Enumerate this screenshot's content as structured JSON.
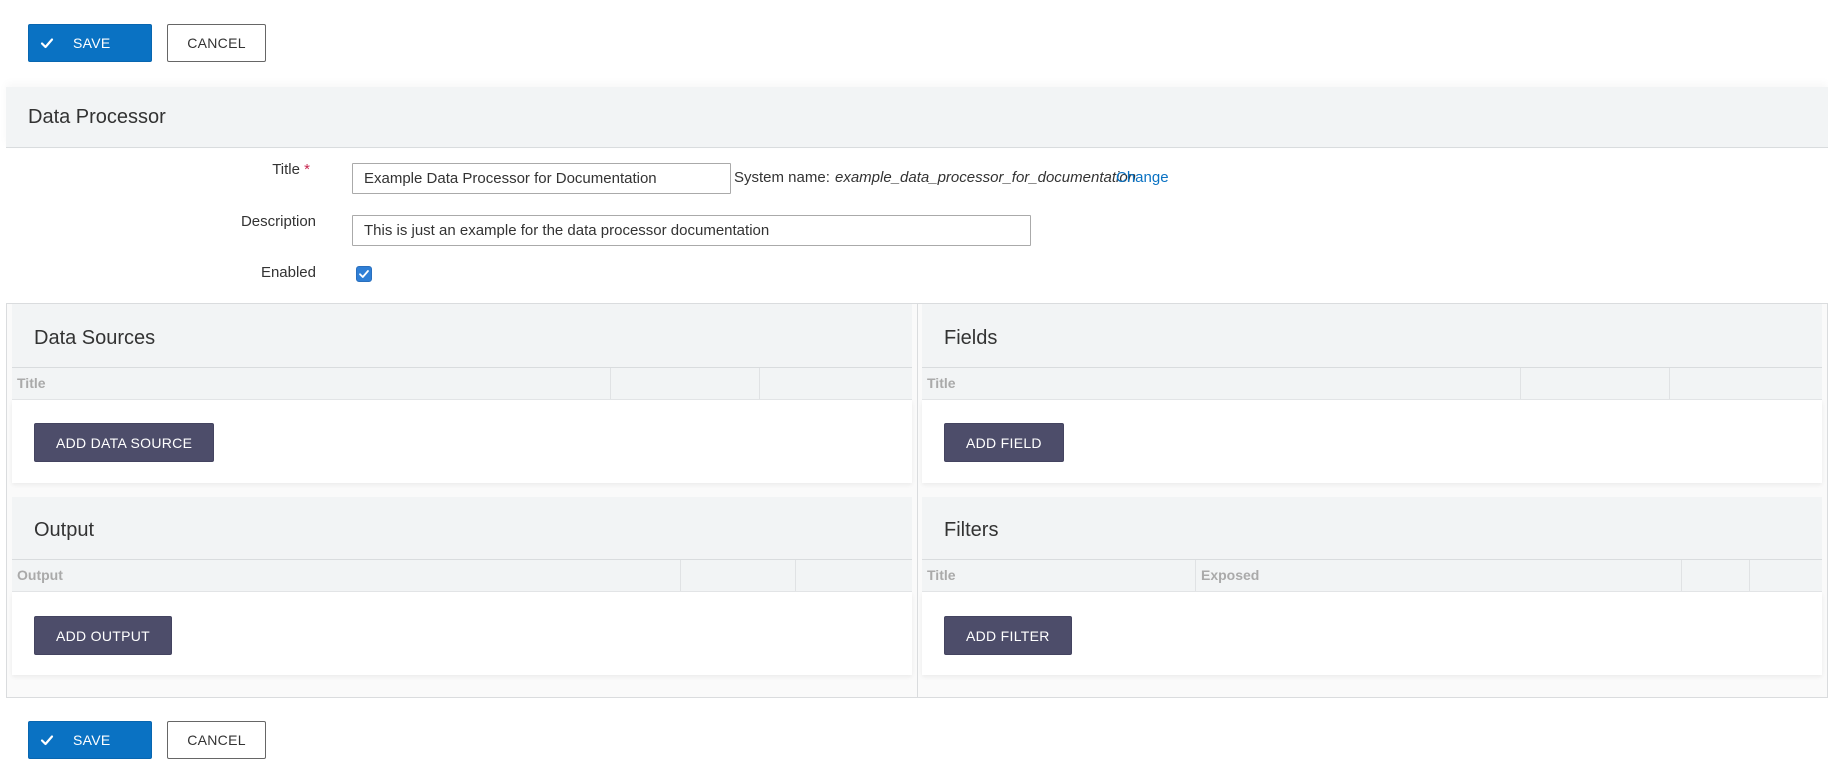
{
  "toolbar": {
    "save_label": "SAVE",
    "cancel_label": "CANCEL"
  },
  "header": {
    "title": "Data Processor"
  },
  "form": {
    "title_label": "Title",
    "required_marker": "*",
    "title_value": "Example Data Processor for Documentation",
    "system_name_label": "System name:",
    "system_name_value": "example_data_processor_for_documentation",
    "change_link": "Change",
    "description_label": "Description",
    "description_value": "This is just an example for the data processor documentation",
    "enabled_label": "Enabled",
    "enabled_checked": true
  },
  "sections": {
    "data_sources": {
      "title": "Data Sources",
      "columns": [
        "Title",
        "",
        ""
      ],
      "add_button": "ADD DATA SOURCE"
    },
    "fields": {
      "title": "Fields",
      "columns": [
        "Title",
        "",
        ""
      ],
      "add_button": "ADD FIELD"
    },
    "output": {
      "title": "Output",
      "columns": [
        "Output",
        "",
        ""
      ],
      "add_button": "ADD OUTPUT"
    },
    "filters": {
      "title": "Filters",
      "columns": [
        "Title",
        "Exposed",
        "",
        ""
      ],
      "add_button": "ADD FILTER"
    }
  },
  "colors": {
    "primary": "#0a72c3",
    "dark_button": "#4d4d6a",
    "panel_bg": "#f2f4f5",
    "required": "#c7254e"
  },
  "icons": {
    "save": "check-icon"
  }
}
